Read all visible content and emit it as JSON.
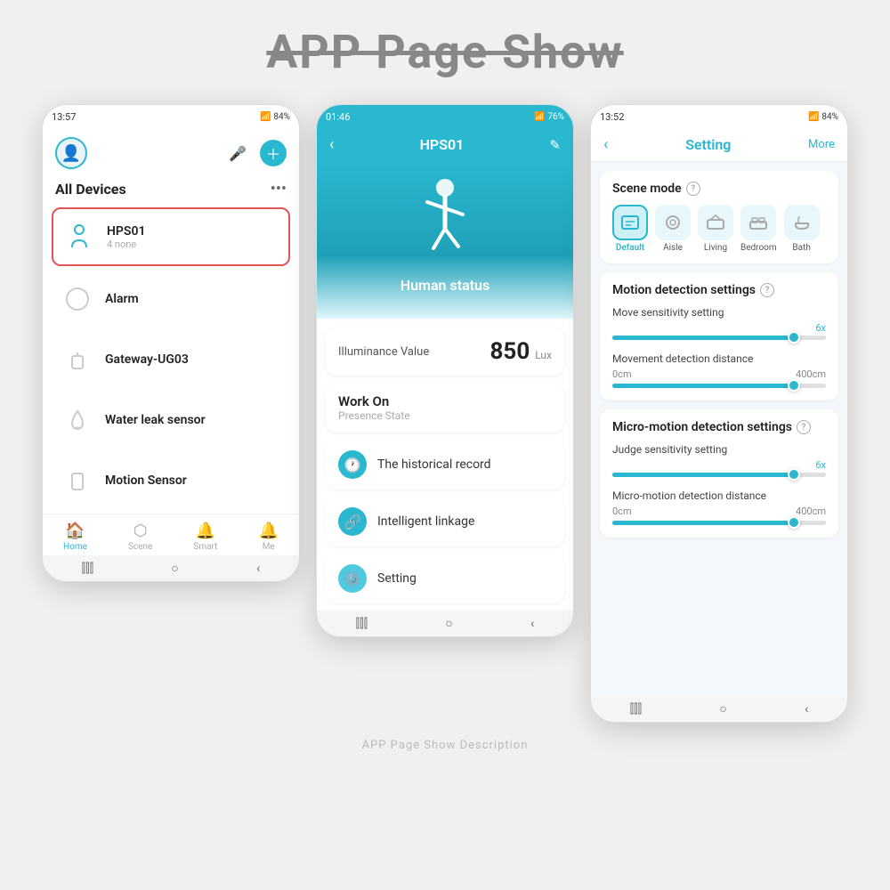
{
  "page": {
    "title": "APP Page Show",
    "footer": "APP Page Show Description"
  },
  "phone1": {
    "status_time": "13:57",
    "status_battery": "84%",
    "header_title": "All Devices",
    "devices": [
      {
        "name": "HPS01",
        "sub": "4 none",
        "icon": "👤",
        "selected": true
      },
      {
        "name": "Alarm",
        "sub": "",
        "icon": "⏰",
        "selected": false
      },
      {
        "name": "Gateway-UG03",
        "sub": "",
        "icon": "📡",
        "selected": false
      },
      {
        "name": "Water leak sensor",
        "sub": "",
        "icon": "💧",
        "selected": false
      },
      {
        "name": "Motion Sensor",
        "sub": "",
        "icon": "🔲",
        "selected": false
      }
    ],
    "bottom_nav": [
      {
        "label": "Home",
        "icon": "🏠",
        "active": true
      },
      {
        "label": "Scene",
        "icon": "⭕",
        "active": false
      },
      {
        "label": "Smart",
        "icon": "🔔",
        "active": false
      },
      {
        "label": "Me",
        "icon": "🔔",
        "active": false
      }
    ]
  },
  "phone2": {
    "status_time": "01:46",
    "status_battery": "76%",
    "title": "HPS01",
    "human_status": "Human status",
    "illuminance_label": "Illuminance Value",
    "illuminance_value": "850",
    "illuminance_unit": "Lux",
    "work_on_title": "Work On",
    "work_on_sub": "Presence State",
    "menu_items": [
      {
        "label": "The historical record",
        "icon": "🕐"
      },
      {
        "label": "Intelligent linkage",
        "icon": "🔗"
      },
      {
        "label": "Setting",
        "icon": "⚙️"
      }
    ]
  },
  "phone3": {
    "status_time": "13:52",
    "status_battery": "84%",
    "title": "Setting",
    "more_label": "More",
    "scene_mode_title": "Scene mode",
    "scene_modes": [
      {
        "label": "Default",
        "icon": "🖥",
        "active": true
      },
      {
        "label": "Aisle",
        "icon": "🔍",
        "active": false
      },
      {
        "label": "Living",
        "icon": "🚗",
        "active": false
      },
      {
        "label": "Bedroom",
        "icon": "🛏",
        "active": false
      },
      {
        "label": "Bath",
        "icon": "🚿",
        "active": false
      }
    ],
    "motion_section_title": "Motion detection settings",
    "move_sensitivity_label": "Move sensitivity setting",
    "move_sensitivity_value": "6x",
    "move_sensitivity_percent": 85,
    "movement_distance_label": "Movement detection distance",
    "movement_distance_min": "0cm",
    "movement_distance_max": "400cm",
    "movement_distance_percent": 85,
    "micro_section_title": "Micro-motion detection settings",
    "judge_sensitivity_label": "Judge sensitivity setting",
    "judge_sensitivity_value": "6x",
    "judge_sensitivity_percent": 85,
    "micro_distance_label": "Micro-motion detection distance",
    "micro_distance_min": "0cm",
    "micro_distance_max": "400cm",
    "micro_distance_percent": 85
  }
}
